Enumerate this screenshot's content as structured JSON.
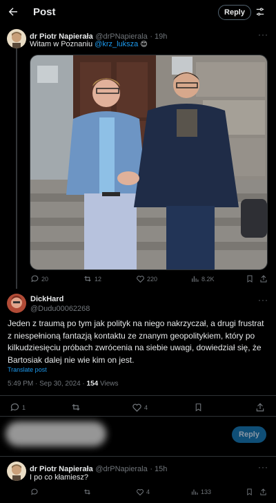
{
  "header": {
    "title": "Post",
    "reply_button": "Reply"
  },
  "post1": {
    "author_name": "dr Piotr Napierała",
    "handle": "@drPNapierala",
    "time": "· 19h",
    "text_prefix": "Witam w Poznaniu ",
    "mention": "@krz_luksza",
    "emoji": "😊",
    "stats": {
      "replies": "20",
      "reposts": "12",
      "likes": "220",
      "views": "8.2K"
    }
  },
  "post2": {
    "author_name": "DickHard",
    "handle": "@Dudu00062268",
    "text": "Jeden z traumą po tym jak polityk na niego nakrzyczał, a drugi frustrat z niespełnioną fantazją kontaktu ze znanym geopolitykiem, który po kilkudziesięciu próbach zwrócenia na siebie uwagi, dowiedział się, że Bartosiak dalej nie wie kim on jest.",
    "translate_label": "Translate post",
    "timestamp": "5:49 PM · Sep 30, 2024 · ",
    "views_count": "154",
    "views_label": " Views",
    "stats": {
      "replies": "1",
      "likes": "4"
    }
  },
  "composer": {
    "reply_button": "Reply"
  },
  "post3": {
    "author_name": "dr Piotr Napierała",
    "handle": "@drPNapierala",
    "time": "· 15h",
    "text": "I po co kłamiesz?",
    "stats": {
      "likes": "4",
      "views": "133"
    }
  },
  "colors": {
    "background": "#000000",
    "accent": "#1d9bf0",
    "muted": "#71767b",
    "divider": "#2f3336"
  }
}
